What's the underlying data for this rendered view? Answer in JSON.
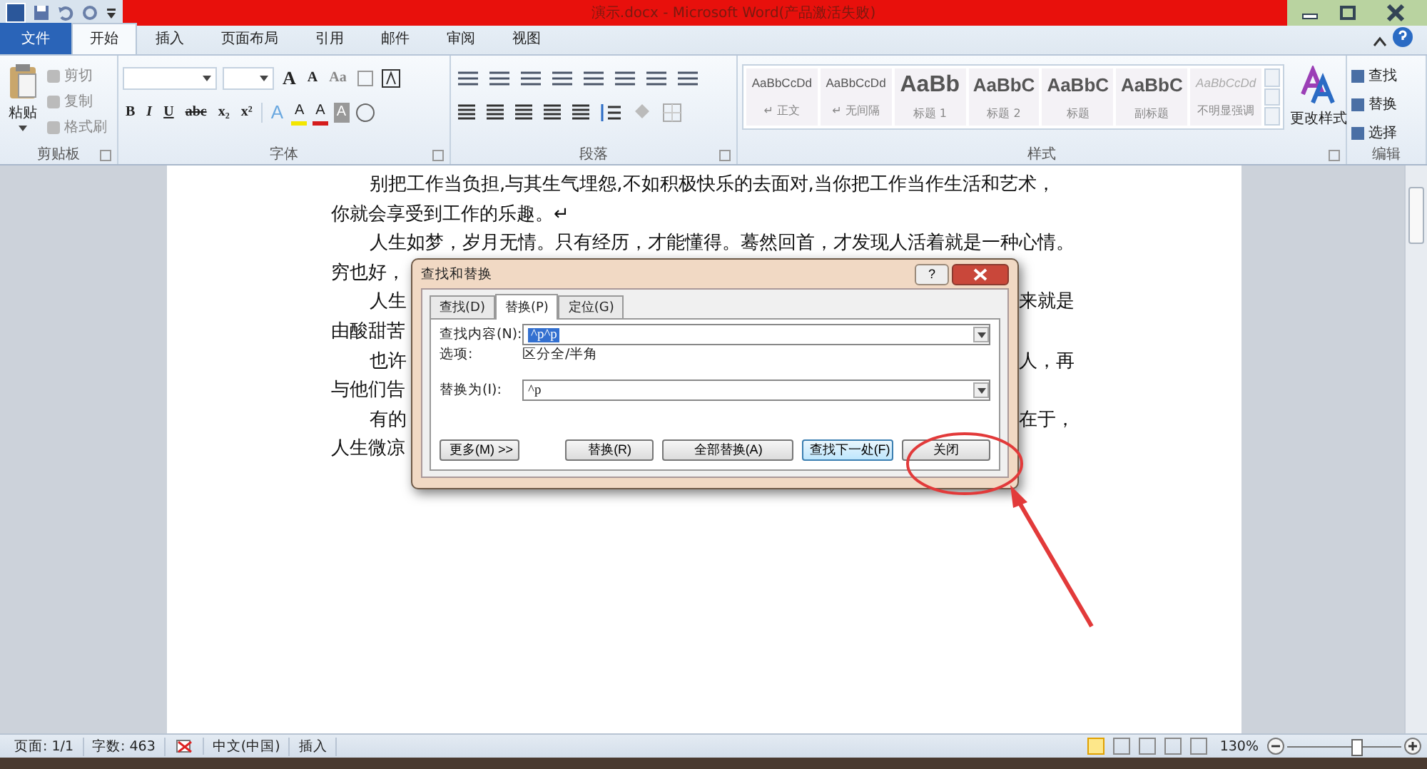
{
  "window": {
    "title": "演示.docx - Microsoft Word(产品激活失败)"
  },
  "tabs": [
    {
      "label": "文件",
      "kind": "file",
      "selected": false
    },
    {
      "label": "开始",
      "kind": "tab",
      "selected": true
    },
    {
      "label": "插入",
      "kind": "tab",
      "selected": false
    },
    {
      "label": "页面布局",
      "kind": "tab",
      "selected": false
    },
    {
      "label": "引用",
      "kind": "tab",
      "selected": false
    },
    {
      "label": "邮件",
      "kind": "tab",
      "selected": false
    },
    {
      "label": "审阅",
      "kind": "tab",
      "selected": false
    },
    {
      "label": "视图",
      "kind": "tab",
      "selected": false
    }
  ],
  "clipboard": {
    "paste": "粘贴",
    "items": [
      "剪切",
      "复制",
      "格式刷"
    ],
    "title": "剪贴板"
  },
  "font": {
    "title": "字体",
    "size_buttons": [
      "A",
      "A"
    ],
    "case_button": "Aa",
    "row2": [
      "B",
      "I",
      "U",
      "abc",
      "x₂",
      "x²"
    ],
    "effects": [
      "A",
      "A",
      "A",
      "A"
    ]
  },
  "paragraph": {
    "title": "段落"
  },
  "styles": {
    "title": "样式",
    "items": [
      {
        "preview": "AaBbCcDd",
        "name": "↵ 正文",
        "kind": "small"
      },
      {
        "preview": "AaBbCcDd",
        "name": "↵ 无间隔",
        "kind": "small"
      },
      {
        "preview": "AaBb",
        "name": "标题 1",
        "kind": "h1"
      },
      {
        "preview": "AaBbC",
        "name": "标题 2",
        "kind": "h2"
      },
      {
        "preview": "AaBbC",
        "name": "标题",
        "kind": "h2"
      },
      {
        "preview": "AaBbC",
        "name": "副标题",
        "kind": "h2"
      },
      {
        "preview": "AaBbCcDd",
        "name": "不明显强调",
        "kind": "faint"
      }
    ]
  },
  "change_styles": "更改样式",
  "editing": {
    "title": "编辑",
    "items": [
      "查找",
      "替换",
      "选择"
    ]
  },
  "document": {
    "lines": [
      {
        "kind": "full",
        "indent": true,
        "text": "别把工作当负担,与其生气埋怨,不如积极快乐的去面对,当你把工作当作生活和艺术，"
      },
      {
        "kind": "full",
        "indent": false,
        "text": "你就会享受到工作的乐趣。↵"
      },
      {
        "kind": "full",
        "indent": true,
        "text": "人生如梦，岁月无情。只有经历，才能懂得。蓦然回首，才发现人活着就是一种心情。"
      },
      {
        "kind": "split",
        "indent": false,
        "left": "穷也好，"
      },
      {
        "kind": "split",
        "indent": true,
        "left": "人生",
        "right": "来就是"
      },
      {
        "kind": "split",
        "indent": false,
        "left": "由酸甜苦"
      },
      {
        "kind": "split",
        "indent": true,
        "left": "也许",
        "right": "人，再"
      },
      {
        "kind": "split",
        "indent": false,
        "left": "与他们告"
      },
      {
        "kind": "split",
        "indent": true,
        "left": "有的",
        "right": "在于，"
      },
      {
        "kind": "split",
        "indent": false,
        "left": "人生微凉"
      }
    ]
  },
  "dialog": {
    "title": "查找和替换",
    "help": "?",
    "tabs": [
      {
        "label": "查找(D)",
        "selected": false
      },
      {
        "label": "替换(P)",
        "selected": true
      },
      {
        "label": "定位(G)",
        "selected": false
      }
    ],
    "find_label": "查找内容(N):",
    "find_value": "^p^p",
    "options_label": "选项:",
    "options_value": "区分全/半角",
    "replace_label": "替换为(I):",
    "replace_value": "^p",
    "buttons": [
      {
        "label": "更多(M) >>",
        "kind": "more",
        "default": false
      },
      {
        "label": "替换(R)",
        "kind": "action",
        "default": false
      },
      {
        "label": "全部替换(A)",
        "kind": "wide",
        "default": false
      },
      {
        "label": "查找下一处(F)",
        "kind": "action",
        "default": true
      },
      {
        "label": "关闭",
        "kind": "action",
        "default": false
      }
    ]
  },
  "status_bar": {
    "page": "页面: 1/1",
    "words": "字数: 463",
    "language": "中文(中国)",
    "mode": "插入",
    "zoom": "130%",
    "zoom_level": {
      "level": 0.6
    }
  }
}
